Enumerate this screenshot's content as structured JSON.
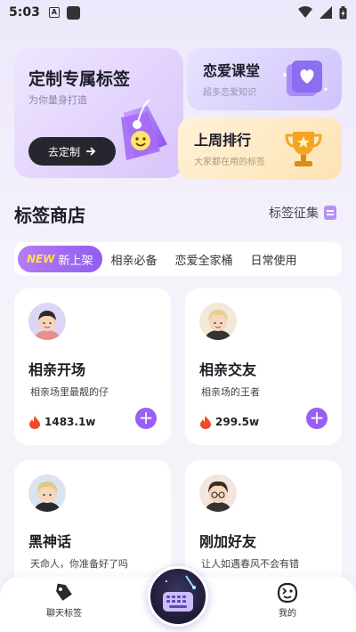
{
  "status_bar": {
    "time": "5:03",
    "badge": "A"
  },
  "banners": {
    "custom": {
      "title": "定制专属标签",
      "subtitle": "为你量身打造",
      "button": "去定制"
    },
    "love_course": {
      "title": "恋爱课堂",
      "subtitle": "超多恋爱知识"
    },
    "weekly_rank": {
      "title": "上周排行",
      "subtitle": "大家都在用的标签"
    }
  },
  "section": {
    "title": "标签商店",
    "link": "标签征集"
  },
  "tabs": [
    {
      "badge": "NEW",
      "label": "新上架",
      "active": true
    },
    {
      "label": "相亲必备"
    },
    {
      "label": "恋爱全家桶"
    },
    {
      "label": "日常使用"
    }
  ],
  "cards": [
    {
      "name": "相亲开场",
      "desc": "相亲场里最靓的仔",
      "count": "1483.1w"
    },
    {
      "name": "相亲交友",
      "desc": "相亲场的王者",
      "count": "299.5w"
    },
    {
      "name": "黑神话",
      "desc": "天命人，你准备好了吗"
    },
    {
      "name": "刚加好友",
      "desc": "让人如遇春风不会有错"
    }
  ],
  "bottom_nav": {
    "left": "聊天标签",
    "right": "我的"
  },
  "colors": {
    "accent": "#9a5ef2",
    "dark": "#26262e"
  }
}
